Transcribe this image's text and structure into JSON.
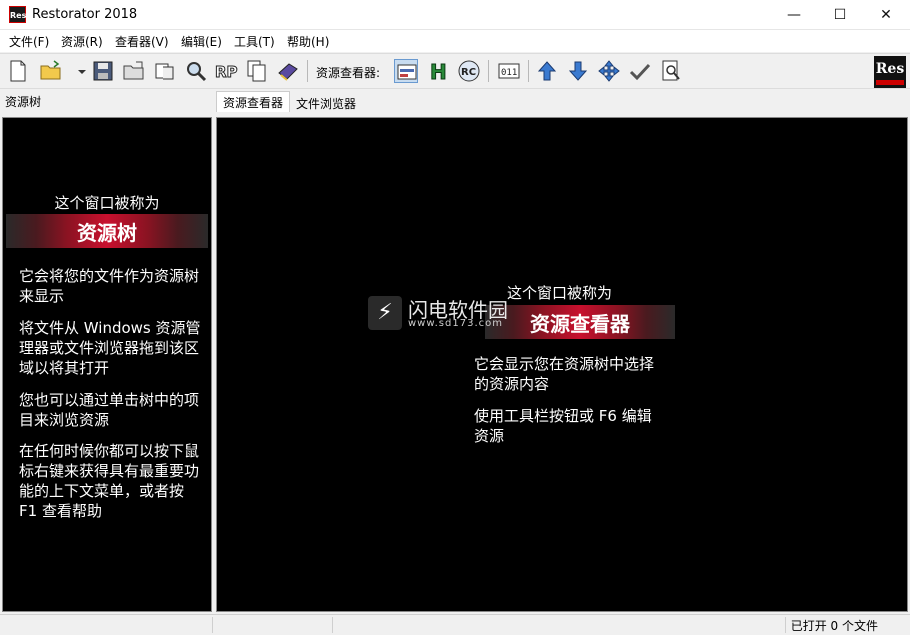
{
  "window": {
    "title": "Restorator 2018",
    "icon_text": "Res",
    "min": "—",
    "max": "☐",
    "close": "✕"
  },
  "menu": [
    "文件(F)",
    "资源(R)",
    "查看器(V)",
    "编辑(E)",
    "工具(T)",
    "帮助(H)"
  ],
  "toolbar": {
    "viewer_label": "资源查看器:",
    "logo": "Res"
  },
  "tree": {
    "pane_title": "资源树",
    "caption": "这个窗口被称为",
    "banner": "资源树",
    "paragraphs": [
      "它会将您的文件作为资源树来显示",
      "将文件从 Windows 资源管理器或文件浏览器拖到该区域以将其打开",
      "您也可以通过单击树中的项目来浏览资源",
      "在任何时候你都可以按下鼠标右键来获得具有最重要功能的上下文菜单，或者按 F1 查看帮助"
    ]
  },
  "tabs": {
    "viewer": "资源查看器",
    "browser": "文件浏览器"
  },
  "viewer": {
    "caption": "这个窗口被称为",
    "banner": "资源查看器",
    "paragraphs": [
      "它会显示您在资源树中选择的资源内容",
      "使用工具栏按钮或 F6 编辑资源"
    ]
  },
  "watermark": {
    "title": "闪电软件园",
    "url": "www.sd173.com"
  },
  "status": {
    "text": "已打开 0 个文件"
  },
  "colors": {
    "banner_red": "#c8102e",
    "pane_bg": "#000000"
  }
}
